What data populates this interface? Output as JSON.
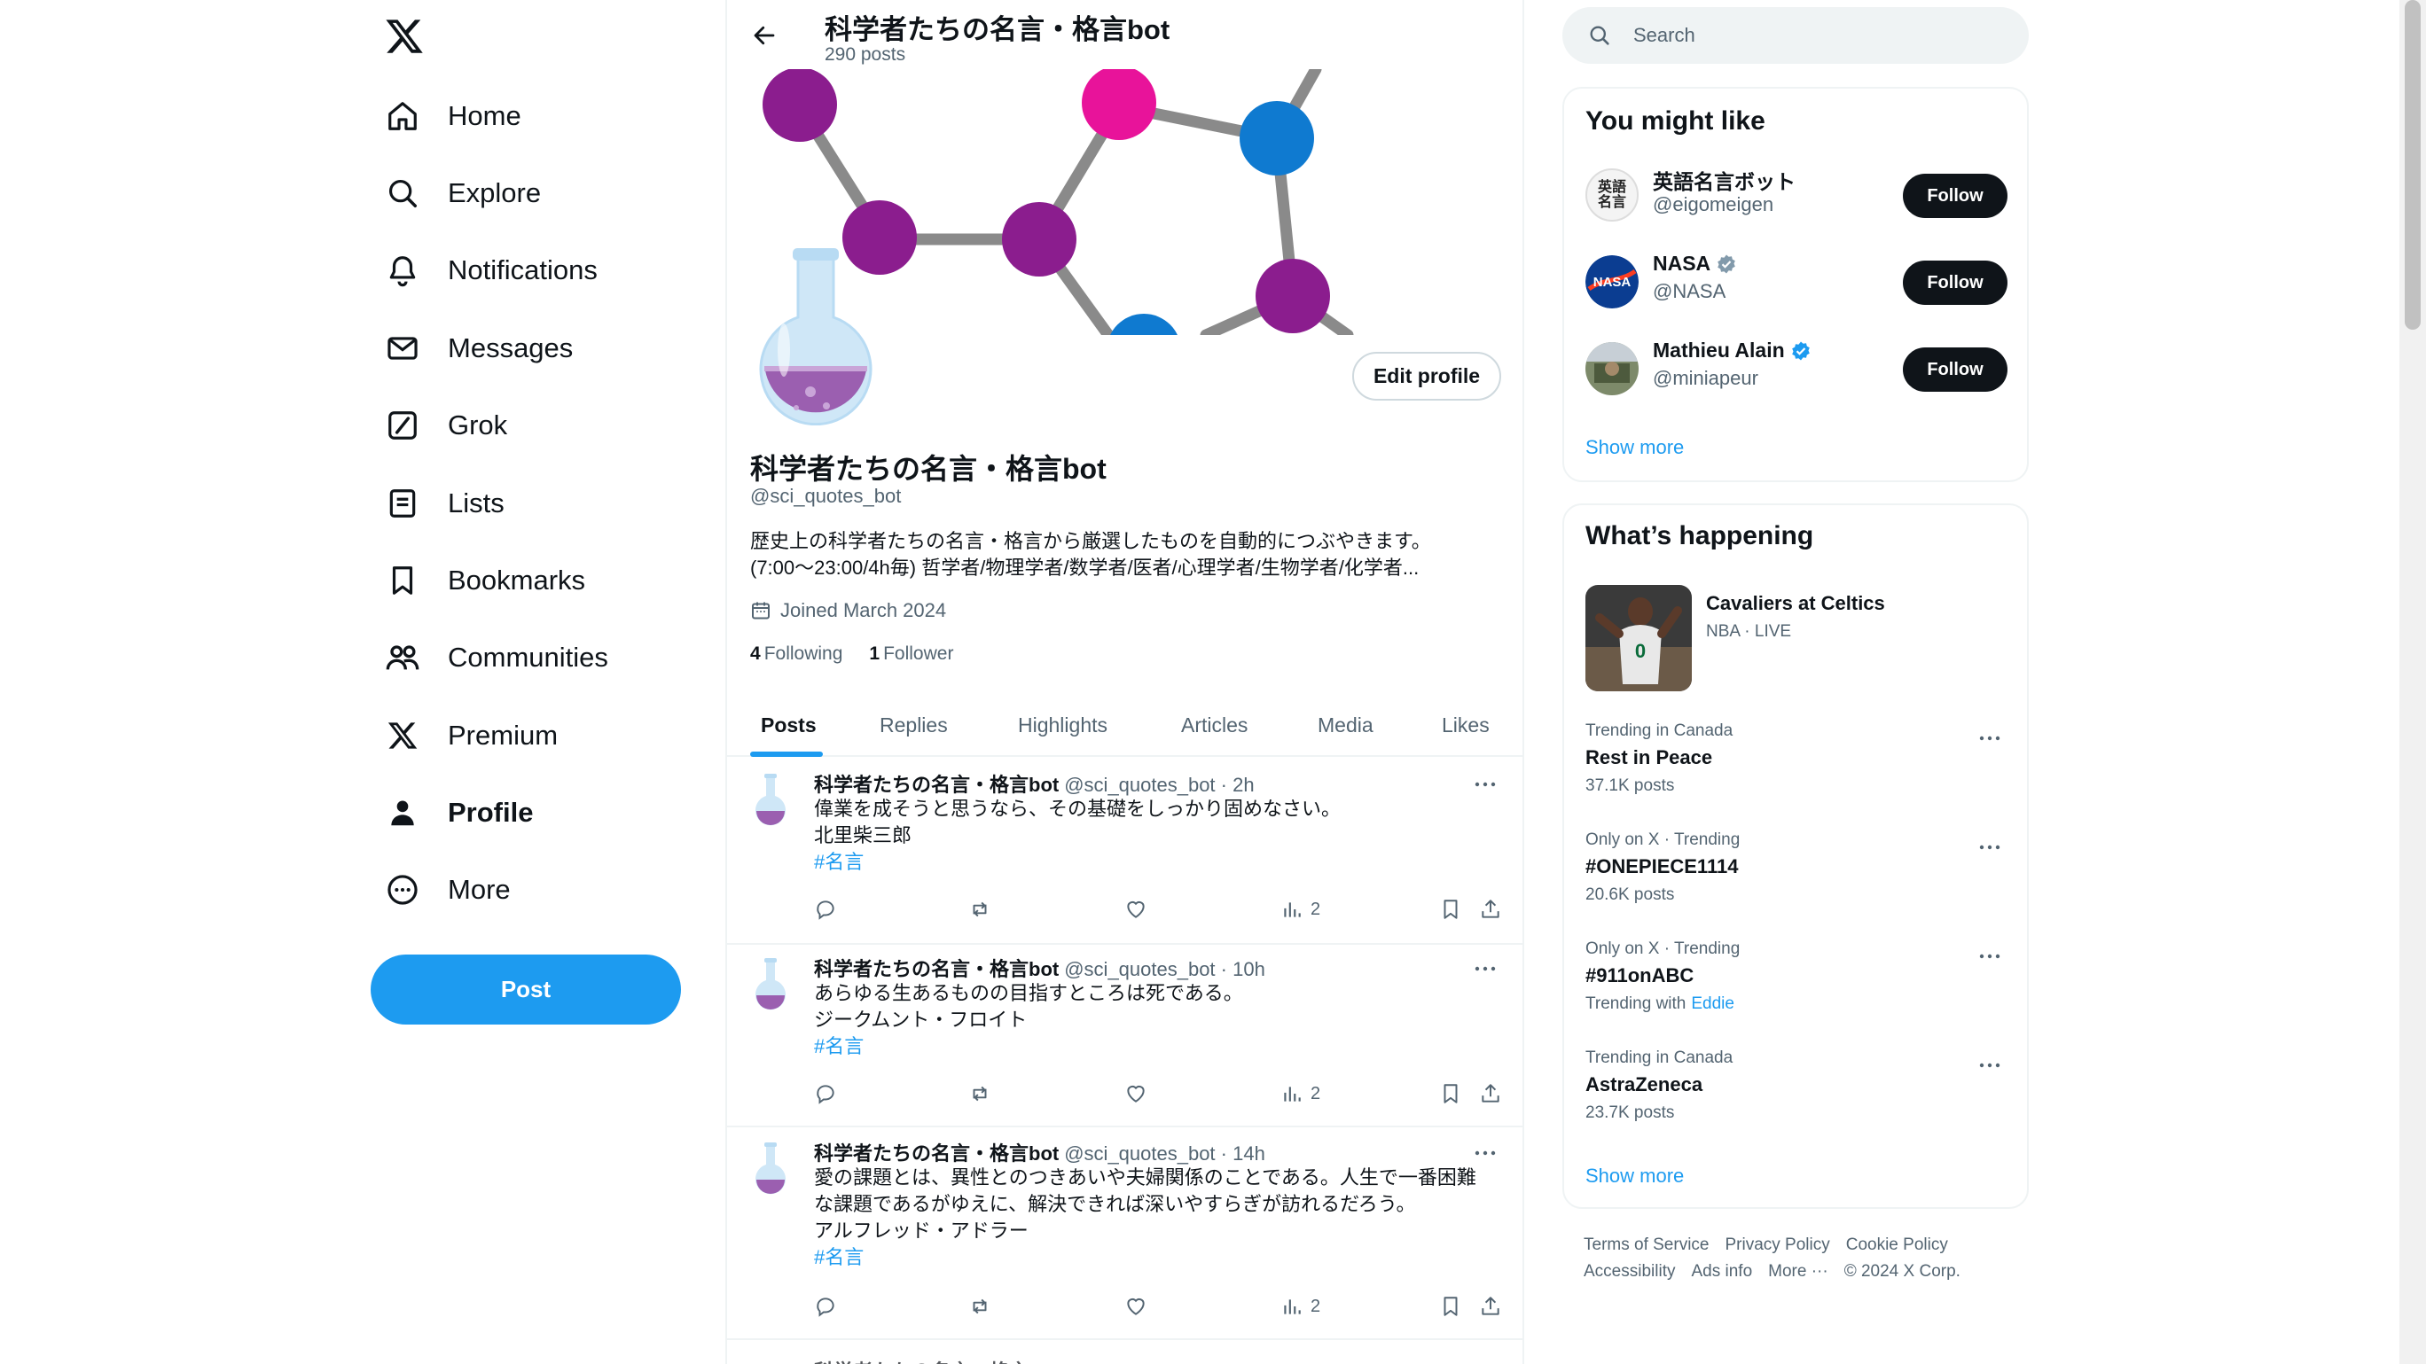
{
  "nav": {
    "items": [
      {
        "label": "Home",
        "icon": "home-icon"
      },
      {
        "label": "Explore",
        "icon": "search-icon"
      },
      {
        "label": "Notifications",
        "icon": "bell-icon"
      },
      {
        "label": "Messages",
        "icon": "envelope-icon"
      },
      {
        "label": "Grok",
        "icon": "grok-icon"
      },
      {
        "label": "Lists",
        "icon": "list-icon"
      },
      {
        "label": "Bookmarks",
        "icon": "bookmark-icon"
      },
      {
        "label": "Communities",
        "icon": "people-icon"
      },
      {
        "label": "Premium",
        "icon": "x-logo-icon"
      },
      {
        "label": "Profile",
        "icon": "person-icon"
      },
      {
        "label": "More",
        "icon": "more-circle-icon"
      }
    ],
    "post_label": "Post"
  },
  "header": {
    "title": "科学者たちの名言・格言bot",
    "posts_count": "290 posts"
  },
  "profile": {
    "name": "科学者たちの名言・格言bot",
    "handle": "@sci_quotes_bot",
    "bio_line1": "歴史上の科学者たちの名言・格言から厳選したものを自動的につぶやきます。",
    "bio_line2": "(7:00～23:00/4h毎) 哲学者/物理学者/数学者/医者/心理学者/生物学者/化学者...",
    "joined": "Joined March 2024",
    "following_count": "4",
    "following_label": "Following",
    "followers_count": "1",
    "followers_label": "Follower",
    "edit_label": "Edit profile"
  },
  "tabs": [
    "Posts",
    "Replies",
    "Highlights",
    "Articles",
    "Media",
    "Likes"
  ],
  "posts": [
    {
      "name": "科学者たちの名言・格言bot",
      "meta": "@sci_quotes_bot · 2h",
      "lines": [
        "偉業を成そうと思うなら、その基礎をしっかり固めなさい。",
        "北里柴三郎"
      ],
      "hashtag": "#名言",
      "views": "2"
    },
    {
      "name": "科学者たちの名言・格言bot",
      "meta": "@sci_quotes_bot · 10h",
      "lines": [
        "あらゆる生あるものの目指すところは死である。",
        "ジークムント・フロイト"
      ],
      "hashtag": "#名言",
      "views": "2"
    },
    {
      "name": "科学者たちの名言・格言bot",
      "meta": "@sci_quotes_bot · 14h",
      "lines": [
        "愛の課題とは、異性とのつきあいや夫婦関係のことである。人生で一番困難",
        "な課題であるがゆえに、解決できれば深いやすらぎが訪れるだろう。",
        "アルフレッド・アドラー"
      ],
      "hashtag": "#名言",
      "views": "2"
    }
  ],
  "search": {
    "placeholder": "Search"
  },
  "you_might_like": {
    "title": "You might like",
    "accounts": [
      {
        "name": "英語名言ボット",
        "handle": "@eigomeigen",
        "verified": false,
        "follow": "Follow"
      },
      {
        "name": "NASA",
        "handle": "@NASA",
        "verified": true,
        "verified_type": "gray",
        "follow": "Follow"
      },
      {
        "name": "Mathieu Alain",
        "handle": "@miniapeur",
        "verified": true,
        "verified_type": "blue",
        "follow": "Follow"
      }
    ],
    "show_more": "Show more",
    "avatar_text": "英語名言"
  },
  "happening": {
    "title": "What’s happening",
    "event": {
      "title": "Cavaliers at Celtics",
      "meta": "NBA · LIVE"
    },
    "trends": [
      {
        "context": "Trending in Canada",
        "name": "Rest in Peace",
        "count": "37.1K posts"
      },
      {
        "context": "Only on X · Trending",
        "name": "#ONEPIECE1114",
        "count": "20.6K posts"
      },
      {
        "context": "Only on X · Trending",
        "name": "#911onABC",
        "count": "Trending with",
        "link": "Eddie"
      },
      {
        "context": "Trending in Canada",
        "name": "AstraZeneca",
        "count": "23.7K posts"
      }
    ],
    "show_more": "Show more"
  },
  "footer": {
    "links": [
      "Terms of Service",
      "Privacy Policy",
      "Cookie Policy",
      "Accessibility",
      "Ads info",
      "More ···",
      "© 2024 X Corp."
    ]
  },
  "colors": {
    "accent": "#1d9bf0",
    "text": "#0f1419",
    "muted": "#536471",
    "border": "#eff3f4"
  }
}
